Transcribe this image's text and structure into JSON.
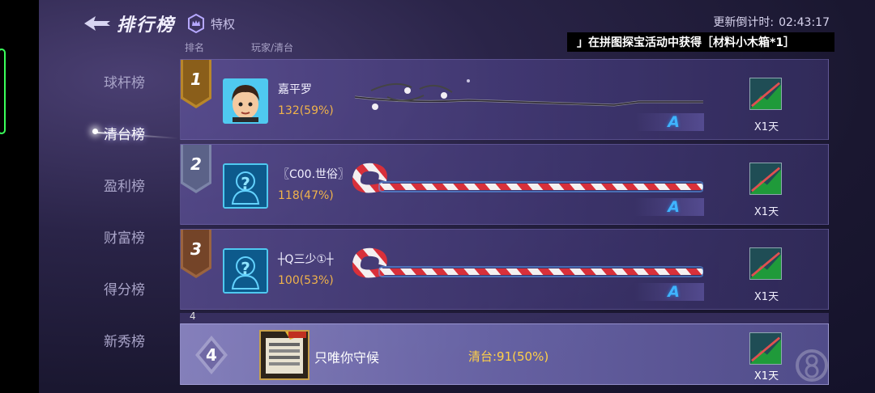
{
  "header": {
    "title": "排行榜",
    "privilege_label": "特权",
    "countdown_label": "更新倒计时:",
    "countdown_value": "02:43:17"
  },
  "notice": "」在拼图探宝活动中获得［材料小木箱*1］",
  "columns": {
    "rank": "排名",
    "player": "玩家/清台"
  },
  "sidebar": {
    "items": [
      {
        "label": "球杆榜",
        "active": false
      },
      {
        "label": "清台榜",
        "active": true
      },
      {
        "label": "盈利榜",
        "active": false
      },
      {
        "label": "财富榜",
        "active": false
      },
      {
        "label": "得分榜",
        "active": false
      },
      {
        "label": "新秀榜",
        "active": false
      }
    ]
  },
  "rows": [
    {
      "rank": "1",
      "name": "嘉平罗",
      "score": "132(59%)",
      "grade": "A",
      "reward": "X1天",
      "cue": "blossom-branch-cue",
      "rank_color": "#c9952f"
    },
    {
      "rank": "2",
      "name": "〖C00.世俗〗",
      "score": "118(47%)",
      "grade": "A",
      "reward": "X1天",
      "cue": "candy-cane-cue",
      "rank_color": "#8b93b8"
    },
    {
      "rank": "3",
      "name": "┼Q三少①┼",
      "score": "100(53%)",
      "grade": "A",
      "reward": "X1天",
      "cue": "candy-cane-cue",
      "rank_color": "#a8714a"
    }
  ],
  "next_row_stub": "4",
  "self": {
    "rank": "4",
    "name": "只唯你守候",
    "score": "清台:91(50%)",
    "reward": "X1天"
  },
  "colors": {
    "score": "#f0b34a",
    "grade": "#3fb4ff",
    "avatar_border": "#4fc9f0"
  }
}
